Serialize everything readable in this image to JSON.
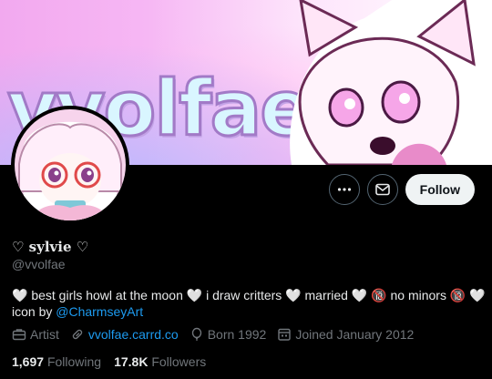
{
  "banner": {
    "title": "vvolfae"
  },
  "profile": {
    "display_name": "♡ sylvie ♡",
    "handle": "@vvolfae",
    "bio_text": "🤍 best girls howl at the moon 🤍 i draw critters 🤍 married 🤍 🔞 no minors 🔞 🤍 icon by ",
    "bio_mention": "@CharmseyArt"
  },
  "actions": {
    "more_icon": "more-horizontal-icon",
    "message_icon": "envelope-icon",
    "follow_label": "Follow"
  },
  "meta": {
    "category": "Artist",
    "website": "vvolfae.carrd.co",
    "birth": "Born 1992",
    "joined": "Joined January 2012"
  },
  "stats": {
    "following_count": "1,697",
    "following_label": "Following",
    "followers_count": "17.8K",
    "followers_label": "Followers"
  },
  "colors": {
    "accent": "#1d9bf0",
    "secondary_text": "#71767b",
    "background": "#000000"
  }
}
